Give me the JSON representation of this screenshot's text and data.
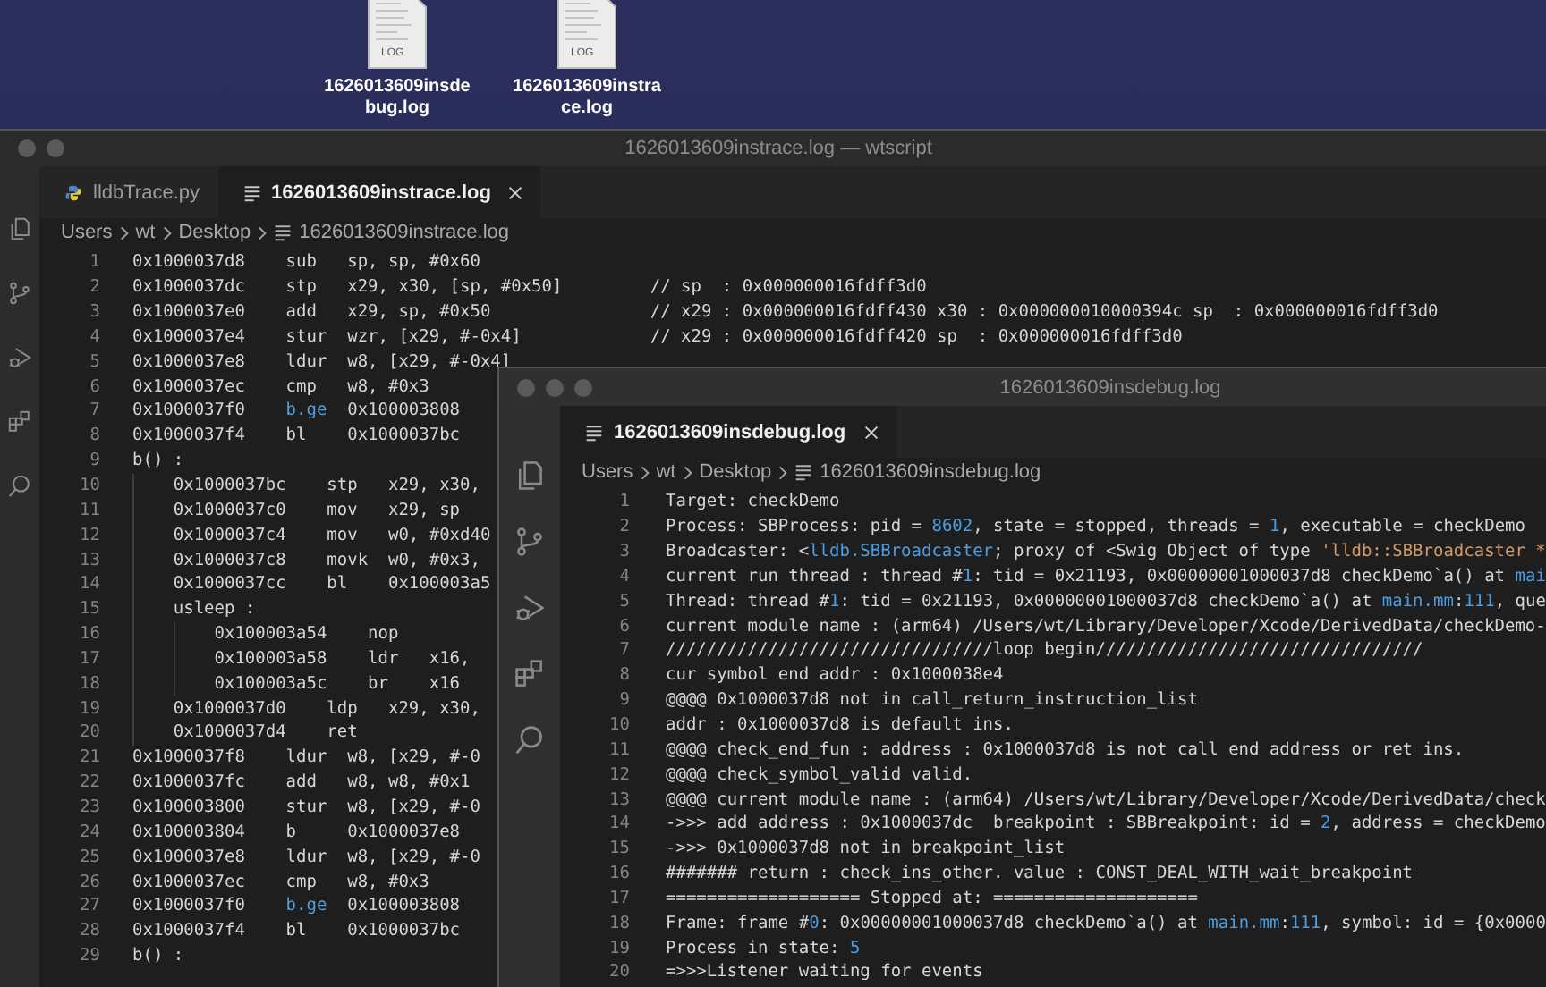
{
  "desktop": {
    "files": [
      {
        "name": "1626013609insdebug.log",
        "badge": "LOG"
      },
      {
        "name": "1626013609instrace.log",
        "badge": "LOG"
      }
    ]
  },
  "back_window": {
    "title": "1626013609instrace.log — wtscript",
    "tabs": [
      {
        "label": "lldbTrace.py",
        "kind": "python",
        "selected": false
      },
      {
        "label": "1626013609instrace.log",
        "kind": "log",
        "selected": true
      }
    ],
    "breadcrumb": [
      "Users",
      "wt",
      "Desktop",
      "1626013609instrace.log"
    ],
    "lines": [
      {
        "num": "1",
        "kind": "instruction",
        "addr": "0x1000037d8",
        "op": "sub",
        "args": "sp, sp, #0x60"
      },
      {
        "num": "2",
        "kind": "instruction",
        "addr": "0x1000037dc",
        "op": "stp",
        "args": "x29, x30, [sp, #0x50]",
        "comment": "// sp  : 0x000000016fdff3d0"
      },
      {
        "num": "3",
        "kind": "instruction",
        "addr": "0x1000037e0",
        "op": "add",
        "args": "x29, sp, #0x50",
        "comment": "// x29 : 0x000000016fdff430 x30 : 0x000000010000394c sp  : 0x000000016fdff3d0"
      },
      {
        "num": "4",
        "kind": "instruction",
        "addr": "0x1000037e4",
        "op": "stur",
        "args": "wzr, [x29, #-0x4]",
        "comment": "// x29 : 0x000000016fdff420 sp  : 0x000000016fdff3d0"
      },
      {
        "num": "5",
        "kind": "instruction",
        "addr": "0x1000037e8",
        "op": "ldur",
        "args": "w8, [x29, #-0x4]"
      },
      {
        "num": "6",
        "kind": "instruction",
        "addr": "0x1000037ec",
        "op": "cmp",
        "args": "w8, #0x3"
      },
      {
        "num": "7",
        "kind": "branch",
        "addr": "0x1000037f0",
        "op": "b.ge",
        "args": "0x100003808"
      },
      {
        "num": "8",
        "kind": "instruction",
        "addr": "0x1000037f4",
        "op": "bl",
        "args": "0x1000037bc"
      },
      {
        "num": "9",
        "kind": "symbol",
        "label": "b() :",
        "children": [
          {
            "num": "10",
            "kind": "instruction",
            "addr": "0x1000037bc",
            "op": "stp",
            "args": "x29, x30,"
          },
          {
            "num": "11",
            "kind": "instruction",
            "addr": "0x1000037c0",
            "op": "mov",
            "args": "x29, sp"
          },
          {
            "num": "12",
            "kind": "instruction",
            "addr": "0x1000037c4",
            "op": "mov",
            "args": "w0, #0xd40"
          },
          {
            "num": "13",
            "kind": "instruction",
            "addr": "0x1000037c8",
            "op": "movk",
            "args": "w0, #0x3,"
          },
          {
            "num": "14",
            "kind": "instruction",
            "addr": "0x1000037cc",
            "op": "bl",
            "args": "0x100003a5"
          },
          {
            "num": "15",
            "kind": "symbol",
            "label": "usleep :",
            "children": [
              {
                "num": "16",
                "kind": "instruction",
                "addr": "0x100003a54",
                "op": "nop"
              },
              {
                "num": "17",
                "kind": "instruction",
                "addr": "0x100003a58",
                "op": "ldr",
                "args": "x16,"
              },
              {
                "num": "18",
                "kind": "instruction",
                "addr": "0x100003a5c",
                "op": "br",
                "args": "x16"
              }
            ]
          },
          {
            "num": "19",
            "kind": "instruction",
            "addr": "0x1000037d0",
            "op": "ldp",
            "args": "x29, x30,"
          },
          {
            "num": "20",
            "kind": "instruction",
            "addr": "0x1000037d4",
            "op": "ret"
          }
        ]
      },
      {
        "num": "21",
        "kind": "instruction",
        "addr": "0x1000037f8",
        "op": "ldur",
        "args": "w8, [x29, #-0"
      },
      {
        "num": "22",
        "kind": "instruction",
        "addr": "0x1000037fc",
        "op": "add",
        "args": "w8, w8, #0x1"
      },
      {
        "num": "23",
        "kind": "instruction",
        "addr": "0x100003800",
        "op": "stur",
        "args": "w8, [x29, #-0"
      },
      {
        "num": "24",
        "kind": "instruction",
        "addr": "0x100003804",
        "op": "b",
        "args": "0x1000037e8"
      },
      {
        "num": "25",
        "kind": "instruction",
        "addr": "0x1000037e8",
        "op": "ldur",
        "args": "w8, [x29, #-0"
      },
      {
        "num": "26",
        "kind": "instruction",
        "addr": "0x1000037ec",
        "op": "cmp",
        "args": "w8, #0x3"
      },
      {
        "num": "27",
        "kind": "branch",
        "addr": "0x1000037f0",
        "op": "b.ge",
        "args": "0x100003808"
      },
      {
        "num": "28",
        "kind": "instruction",
        "addr": "0x1000037f4",
        "op": "bl",
        "args": "0x1000037bc"
      },
      {
        "num": "29",
        "kind": "symbol",
        "label": "b() :"
      }
    ]
  },
  "front_window": {
    "title": "1626013609insdebug.log",
    "tabs": [
      {
        "label": "1626013609insdebug.log",
        "kind": "log",
        "selected": true
      }
    ],
    "breadcrumb": [
      "Users",
      "wt",
      "Desktop",
      "1626013609insdebug.log"
    ],
    "lines": [
      {
        "num": "1",
        "segments": [
          {
            "text": "Target: checkDemo",
            "kind": "plain"
          }
        ]
      },
      {
        "num": "2",
        "segments": [
          {
            "text": "Process: SBProcess: pid = ",
            "kind": "plain"
          },
          {
            "text": "8602",
            "kind": "number"
          },
          {
            "text": ", state = stopped, threads = ",
            "kind": "plain"
          },
          {
            "text": "1",
            "kind": "number"
          },
          {
            "text": ", executable = checkDemo",
            "kind": "plain"
          }
        ]
      },
      {
        "num": "3",
        "segments": [
          {
            "text": "Broadcaster: <",
            "kind": "plain"
          },
          {
            "text": "lldb.SBBroadcaster",
            "kind": "link"
          },
          {
            "text": "; proxy of <Swig Object of type ",
            "kind": "plain"
          },
          {
            "text": "'lldb::SBBroadcaster *",
            "kind": "string"
          }
        ]
      },
      {
        "num": "4",
        "segments": [
          {
            "text": "current run thread : thread #",
            "kind": "plain"
          },
          {
            "text": "1",
            "kind": "number"
          },
          {
            "text": ": tid = 0x21193, 0x00000001000037d8 checkDemo`a() at ",
            "kind": "plain"
          },
          {
            "text": "mai",
            "kind": "link"
          }
        ]
      },
      {
        "num": "5",
        "segments": [
          {
            "text": "Thread: thread #",
            "kind": "plain"
          },
          {
            "text": "1",
            "kind": "number"
          },
          {
            "text": ": tid = 0x21193, 0x00000001000037d8 checkDemo`a() at ",
            "kind": "plain"
          },
          {
            "text": "main.mm",
            "kind": "link"
          },
          {
            "text": ":",
            "kind": "plain"
          },
          {
            "text": "111",
            "kind": "number"
          },
          {
            "text": ", que",
            "kind": "plain"
          }
        ]
      },
      {
        "num": "6",
        "segments": [
          {
            "text": "current module name : (arm64) /Users/wt/Library/Developer/Xcode/DerivedData/checkDemo-",
            "kind": "plain"
          }
        ]
      },
      {
        "num": "7",
        "segments": [
          {
            "text": "////////////////////////////////loop begin////////////////////////////////",
            "kind": "plain"
          }
        ]
      },
      {
        "num": "8",
        "segments": [
          {
            "text": "cur symbol end addr : 0x1000038e4",
            "kind": "plain"
          }
        ]
      },
      {
        "num": "9",
        "segments": [
          {
            "text": "@@@@ 0x1000037d8 not in call_return_instruction_list",
            "kind": "plain"
          }
        ]
      },
      {
        "num": "10",
        "segments": [
          {
            "text": "addr : 0x1000037d8 is default ins.",
            "kind": "plain"
          }
        ]
      },
      {
        "num": "11",
        "segments": [
          {
            "text": "@@@@ check_end_fun : address : 0x1000037d8 is not call end address or ret ins.",
            "kind": "plain"
          }
        ]
      },
      {
        "num": "12",
        "segments": [
          {
            "text": "@@@@ check_symbol_valid valid.",
            "kind": "plain"
          }
        ]
      },
      {
        "num": "13",
        "segments": [
          {
            "text": "@@@@ current module name : (arm64) /Users/wt/Library/Developer/Xcode/DerivedData/check",
            "kind": "plain"
          }
        ]
      },
      {
        "num": "14",
        "segments": [
          {
            "text": "->>> add address : 0x1000037dc  breakpoint : SBBreakpoint: id = ",
            "kind": "plain"
          },
          {
            "text": "2",
            "kind": "number"
          },
          {
            "text": ", address = checkDemo",
            "kind": "plain"
          }
        ]
      },
      {
        "num": "15",
        "segments": [
          {
            "text": "->>> 0x1000037d8 not in breakpoint_list",
            "kind": "plain"
          }
        ]
      },
      {
        "num": "16",
        "segments": [
          {
            "text": "####### return : check_ins_other. value : CONST_DEAL_WITH_wait_breakpoint",
            "kind": "plain"
          }
        ]
      },
      {
        "num": "17",
        "segments": [
          {
            "text": "=================== Stopped at: ====================",
            "kind": "plain"
          }
        ]
      },
      {
        "num": "18",
        "segments": [
          {
            "text": "Frame: frame #",
            "kind": "plain"
          },
          {
            "text": "0",
            "kind": "number"
          },
          {
            "text": ": 0x00000001000037d8 checkDemo`a() at ",
            "kind": "plain"
          },
          {
            "text": "main.mm",
            "kind": "link"
          },
          {
            "text": ":",
            "kind": "plain"
          },
          {
            "text": "111",
            "kind": "number"
          },
          {
            "text": ", symbol: id = {0x0000",
            "kind": "plain"
          }
        ]
      },
      {
        "num": "19",
        "segments": [
          {
            "text": "Process in state: ",
            "kind": "plain"
          },
          {
            "text": "5",
            "kind": "number"
          }
        ]
      },
      {
        "num": "20",
        "segments": [
          {
            "text": "=>>>Listener waiting for events",
            "kind": "plain"
          }
        ]
      }
    ]
  }
}
